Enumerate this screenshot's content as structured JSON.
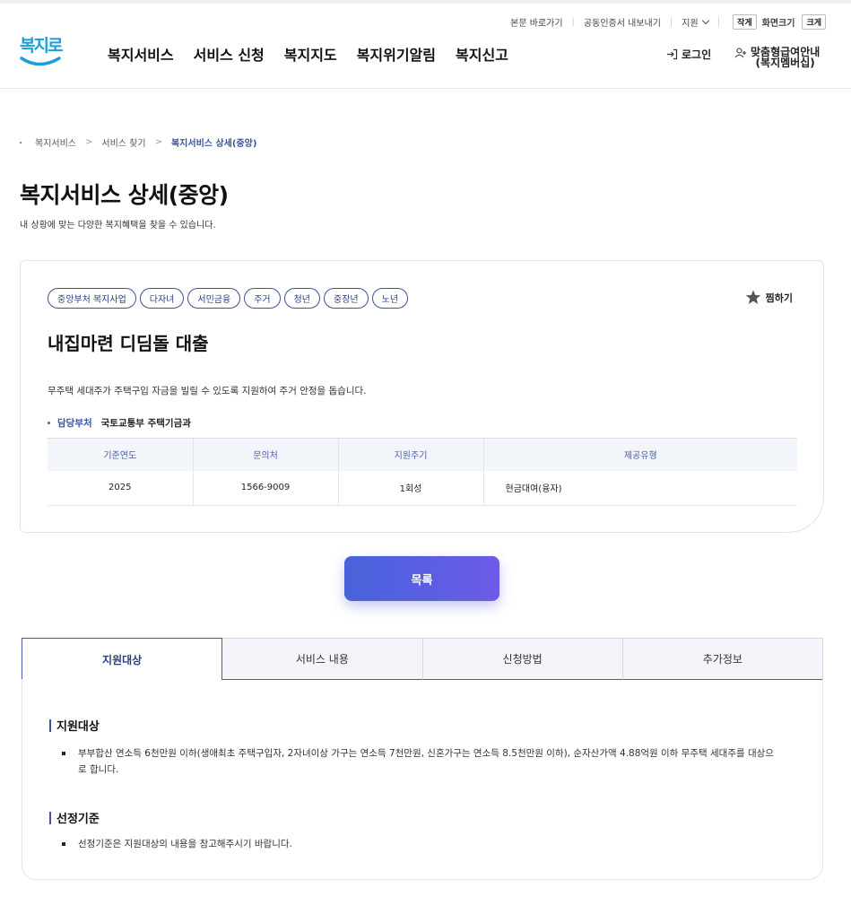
{
  "utility": {
    "skip_to_content": "본문 바로가기",
    "cert_export": "공동인증서 내보내기",
    "language": "지원",
    "small_label": "작게",
    "font_size_label": "화면크기",
    "large_label": "크게"
  },
  "logo": {
    "text": "복지로"
  },
  "nav": [
    "복지서비스",
    "서비스 신청",
    "복지지도",
    "복지위기알림",
    "복지신고"
  ],
  "header": {
    "login": "로그인",
    "member_line1": "맞춤형급여안내",
    "member_line2": "(복지멤버십)"
  },
  "breadcrumb": [
    "복지서비스",
    "서비스 찾기",
    "복지서비스 상세(중앙)"
  ],
  "page": {
    "title": "복지서비스 상세(중앙)",
    "subtitle": "내 상황에 맞는 다양한 복지혜택을 찾을 수 있습니다."
  },
  "service": {
    "tags": [
      "중앙부처 복지사업",
      "다자녀",
      "서민금융",
      "주거",
      "청년",
      "중장년",
      "노년"
    ],
    "bookmark": "찜하기",
    "title": "내집마련 디딤돌 대출",
    "description": "무주택 세대주가 주택구입 자금을 빌릴 수 있도록 지원하여 주거 안정을 돕습니다.",
    "dept_label": "담당부처",
    "dept_value": "국토교통부 주택기금과",
    "table": {
      "headers": [
        "기준연도",
        "문의처",
        "지원주기",
        "제공유형"
      ],
      "row": [
        "2025",
        "1566-9009",
        "1회성",
        "현금대여(융자)"
      ]
    }
  },
  "list_button": "목록",
  "tabs": [
    "지원대상",
    "서비스 내용",
    "신청방법",
    "추가정보"
  ],
  "target": {
    "title": "지원대상",
    "item": "부부합산 연소득 6천만원 이하(생애최초 주택구입자, 2자녀이상 가구는 연소득 7천만원, 신혼가구는 연소득 8.5천만원 이하), 순자산가액 4.88억원 이하 무주택 세대주를 대상으로 합니다."
  },
  "criteria": {
    "title": "선정기준",
    "item": "선정기준은 지원대상의 내용을 참고해주시기 바랍니다."
  },
  "colors": {
    "accent": "#3a53a4",
    "button_start": "#4762db",
    "button_end": "#6c5be8",
    "logo_blue": "#1aa0d8"
  }
}
